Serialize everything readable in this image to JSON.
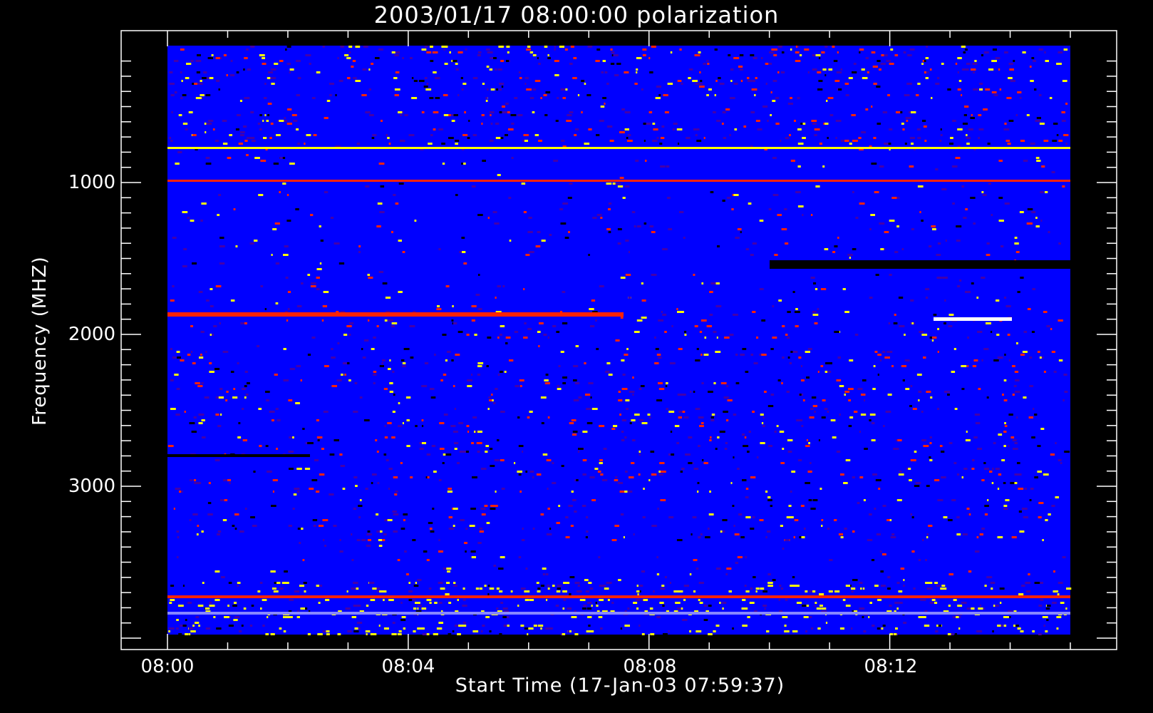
{
  "chart_data": {
    "type": "heatmap",
    "title": "2003/01/17 08:00:00 polarization",
    "xlabel": "Start Time (17-Jan-03 07:59:37)",
    "ylabel": "Frequency (MHZ)",
    "x_ticks": [
      "08:00",
      "08:04",
      "08:08",
      "08:12"
    ],
    "y_ticks": [
      "1000",
      "2000",
      "3000"
    ],
    "x_range_minutes": [
      0,
      15
    ],
    "y_range_mhz": [
      100,
      4000
    ],
    "y_axis_reversed": true,
    "colors": {
      "background": "#000000",
      "base": "#0000ff",
      "low": "#4400aa",
      "mid": "#ff2200",
      "high": "#ffff00",
      "dark": "#000000"
    }
  }
}
